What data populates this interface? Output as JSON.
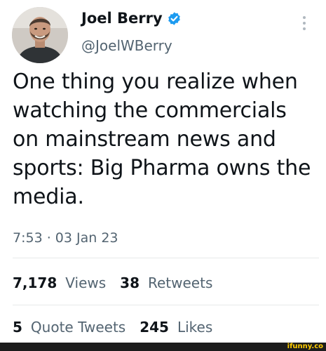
{
  "author": {
    "display_name": "Joel Berry",
    "handle": "@JoelWBerry",
    "verified": true
  },
  "tweet": {
    "text": "One thing you realize when watching the commercials on mainstream news and sports: Big Pharma owns the media.",
    "timestamp": "7:53 · 03 Jan 23"
  },
  "stats": {
    "views_count": "7,178",
    "views_label": "Views",
    "retweets_count": "38",
    "retweets_label": "Retweets",
    "quote_count": "5",
    "quote_label": "Quote Tweets",
    "likes_count": "245",
    "likes_label": "Likes"
  },
  "watermark": "ifunny.co",
  "colors": {
    "text_primary": "#0f1419",
    "text_secondary": "#536471",
    "verified_blue": "#1d9bf0",
    "divider": "#e7e9ea",
    "watermark_yellow": "#ffcc00"
  }
}
